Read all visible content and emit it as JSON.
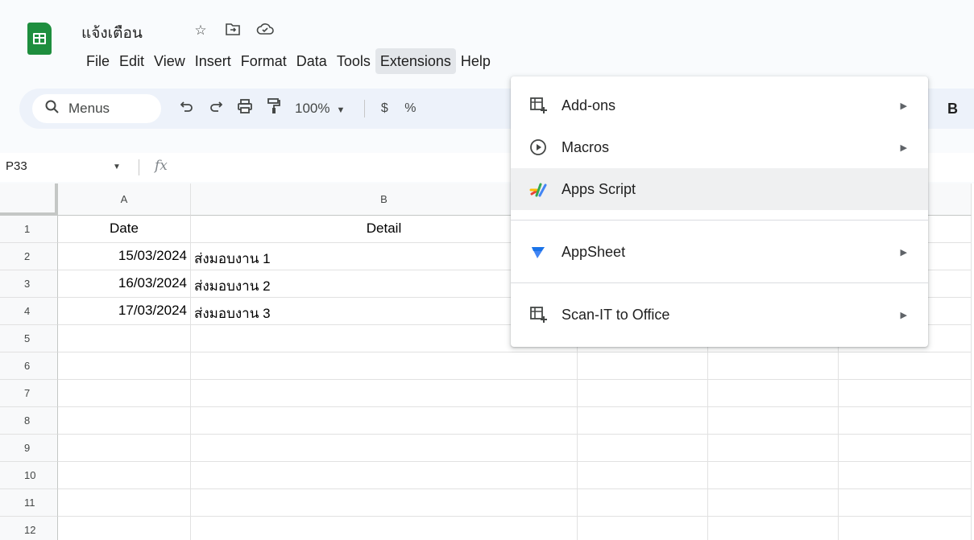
{
  "app": {
    "doc_title": "แจ้งเตือน",
    "title_icons": [
      "star-icon",
      "move-to-folder-icon",
      "cloud-saved-icon"
    ]
  },
  "menubar": {
    "items": [
      "File",
      "Edit",
      "View",
      "Insert",
      "Format",
      "Data",
      "Tools",
      "Extensions",
      "Help"
    ],
    "active": "Extensions"
  },
  "toolbar": {
    "search_label": "Menus",
    "zoom": "100%",
    "currency": "$",
    "percent": "%",
    "bold": "B"
  },
  "formula_bar": {
    "name_box": "P33",
    "fx": "fx"
  },
  "sheet": {
    "columns": [
      "A",
      "B"
    ],
    "rows": [
      "1",
      "2",
      "3",
      "4",
      "5",
      "6",
      "7",
      "8",
      "9",
      "10",
      "11",
      "12"
    ],
    "cells": {
      "A1": "Date",
      "B1": "Detail",
      "A2": "15/03/2024",
      "B2": "ส่งมอบงาน 1",
      "A3": "16/03/2024",
      "B3": "ส่งมอบงาน 2",
      "A4": "17/03/2024",
      "B4": "ส่งมอบงาน 3"
    }
  },
  "extensions_menu": {
    "items": [
      {
        "label": "Add-ons",
        "icon": "add-ons-icon",
        "submenu": true
      },
      {
        "label": "Macros",
        "icon": "macros-play-icon",
        "submenu": true
      },
      {
        "label": "Apps Script",
        "icon": "apps-script-icon",
        "submenu": false,
        "highlighted": true
      },
      {
        "label": "AppSheet",
        "icon": "appsheet-icon",
        "submenu": true
      },
      {
        "label": "Scan-IT to Office",
        "icon": "scan-it-addon-icon",
        "submenu": true
      }
    ]
  },
  "colors": {
    "sheets_green": "#1e8e3e",
    "toolbar_bg": "#edf2fa",
    "menu_hover": "#eff0f1",
    "appsheet_blue": "#4285f4"
  }
}
